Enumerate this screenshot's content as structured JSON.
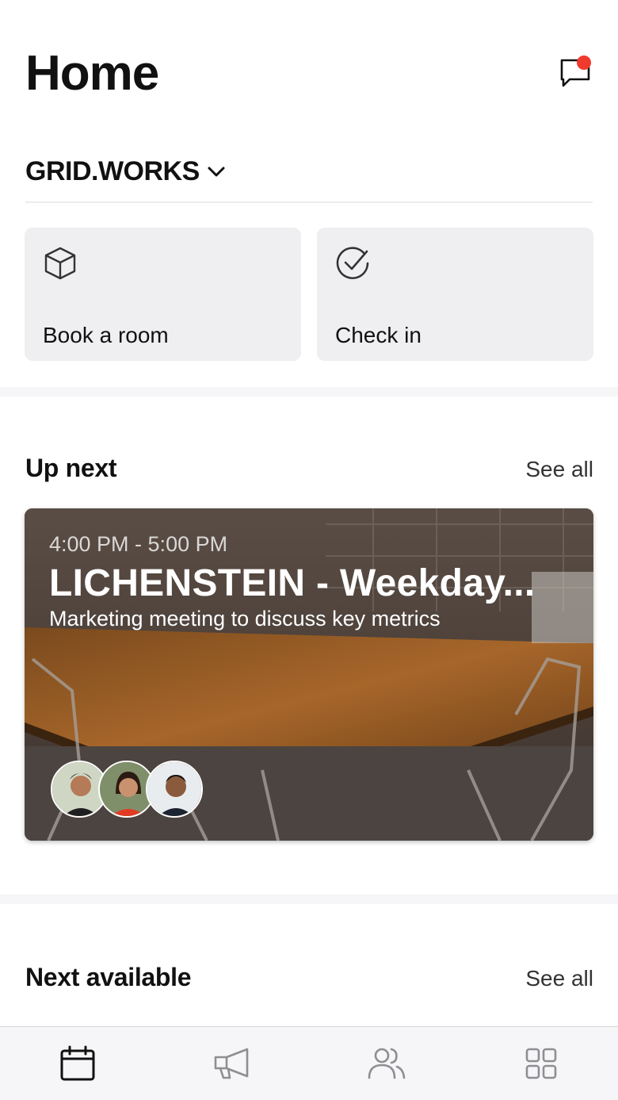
{
  "header": {
    "title": "Home",
    "messages_icon": "chat-bubble-icon",
    "has_unread": true
  },
  "workspace": {
    "name": "GRID.WORKS",
    "icon": "chevron-down-icon"
  },
  "quick_actions": [
    {
      "label": "Book a room",
      "icon": "cube-icon"
    },
    {
      "label": "Check in",
      "icon": "check-circle-icon"
    }
  ],
  "up_next": {
    "title": "Up next",
    "see_all": "See all",
    "meeting": {
      "time": "4:00 PM - 5:00 PM",
      "title": "LICHENSTEIN - Weekday...",
      "description": "Marketing meeting to discuss key metrics",
      "attendee_count": 3
    }
  },
  "next_available": {
    "title": "Next available",
    "see_all": "See all"
  },
  "tabs": [
    {
      "name": "calendar",
      "icon": "calendar-icon",
      "active": true
    },
    {
      "name": "announcements",
      "icon": "megaphone-icon",
      "active": false
    },
    {
      "name": "people",
      "icon": "people-icon",
      "active": false
    },
    {
      "name": "apps",
      "icon": "grid-icon",
      "active": false
    }
  ],
  "colors": {
    "accent_dot": "#f03a2e",
    "tile_bg": "#efeff2",
    "text": "#111111",
    "inactive_icon": "#8e8e93"
  }
}
